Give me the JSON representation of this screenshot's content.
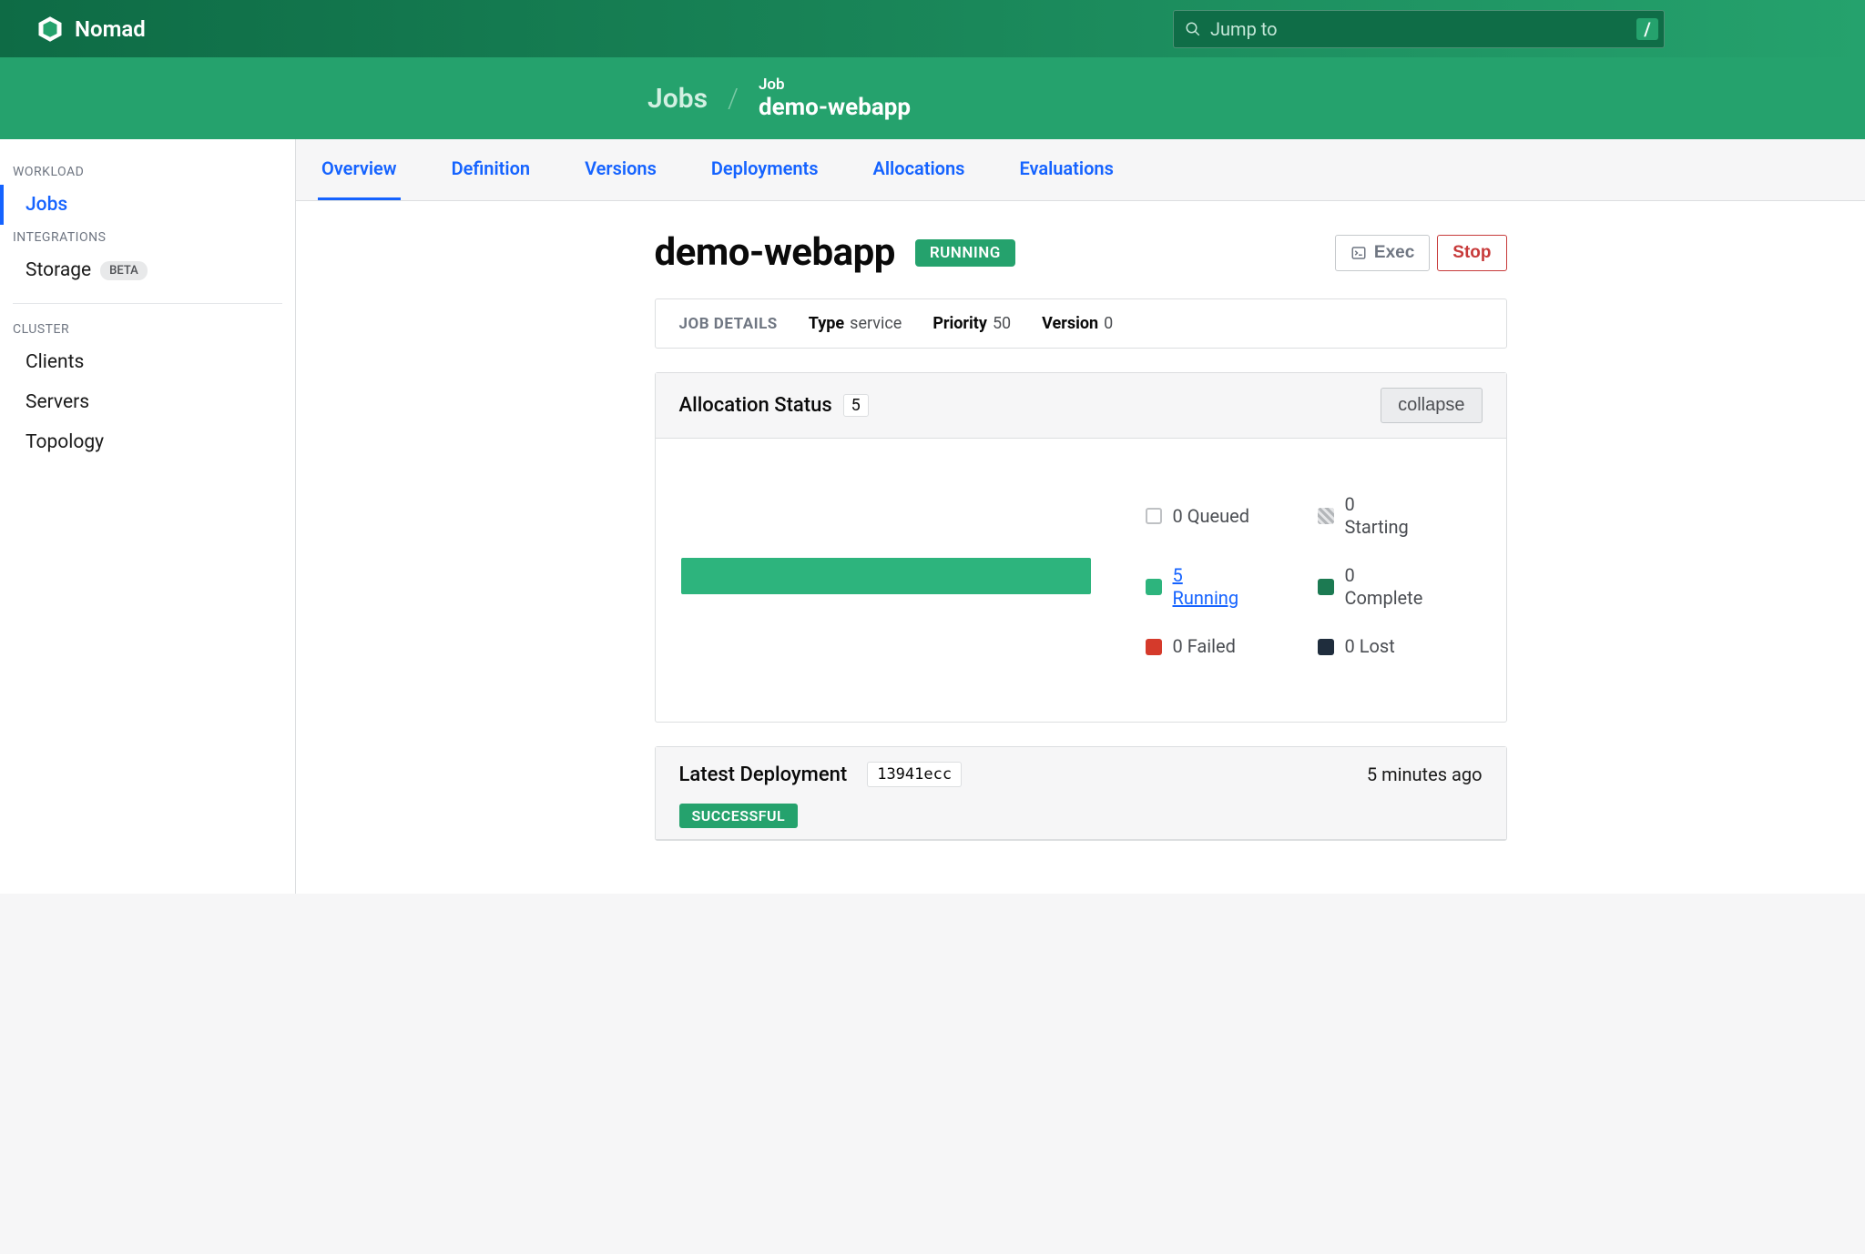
{
  "brand": "Nomad",
  "search": {
    "placeholder": "Jump to",
    "kbd": "/"
  },
  "breadcrumb": {
    "root": "Jobs",
    "label": "Job",
    "name": "demo-webapp"
  },
  "sidebar": {
    "sections": {
      "workload": {
        "label": "WORKLOAD",
        "items": [
          "Jobs"
        ]
      },
      "integrations": {
        "label": "INTEGRATIONS",
        "items": [
          "Storage"
        ],
        "beta": "BETA"
      },
      "cluster": {
        "label": "CLUSTER",
        "items": [
          "Clients",
          "Servers",
          "Topology"
        ]
      }
    }
  },
  "tabs": [
    "Overview",
    "Definition",
    "Versions",
    "Deployments",
    "Allocations",
    "Evaluations"
  ],
  "job": {
    "name": "demo-webapp",
    "status": "RUNNING",
    "exec": "Exec",
    "stop": "Stop",
    "details_label": "JOB DETAILS",
    "type_label": "Type",
    "type": "service",
    "priority_label": "Priority",
    "priority": "50",
    "version_label": "Version",
    "version": "0"
  },
  "alloc": {
    "title": "Allocation Status",
    "count": "5",
    "collapse": "collapse",
    "legend": {
      "queued": "0 Queued",
      "starting_n": "0",
      "starting_t": "Starting",
      "running_n": "5",
      "running_t": "Running",
      "complete_n": "0",
      "complete_t": "Complete",
      "failed": "0 Failed",
      "lost": "0 Lost"
    }
  },
  "deploy": {
    "title": "Latest Deployment",
    "id": "13941ecc",
    "time": "5 minutes ago",
    "status": "SUCCESSFUL"
  }
}
